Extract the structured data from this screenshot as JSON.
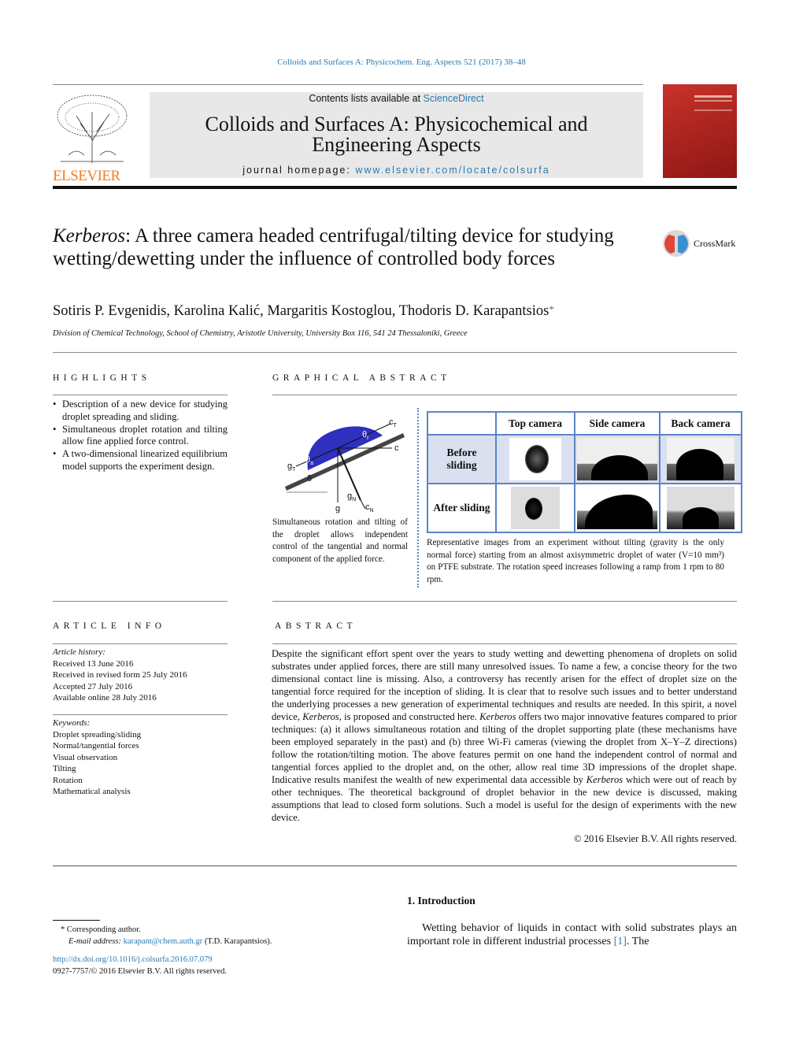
{
  "header": {
    "journal_reference": "Colloids and Surfaces A: Physicochem. Eng. Aspects 521 (2017) 38–48",
    "contents_prefix": "Contents lists available at ",
    "contents_link": "ScienceDirect",
    "journal_title": "Colloids and Surfaces A: Physicochemical and Engineering Aspects",
    "homepage_prefix": "journal homepage: ",
    "homepage_url": "www.elsevier.com/locate/colsurfa",
    "publisher_logo": "ELSEVIER",
    "crossmark": "CrossMark",
    "colors": {
      "link": "#2a7ab0",
      "elsevier_orange": "#f07e26",
      "cover_red": "#b0201e"
    }
  },
  "article": {
    "title_italic": "Kerberos",
    "title_rest": ": A three camera headed centrifugal/tilting device for studying wetting/dewetting under the influence of controlled body forces",
    "authors": "Sotiris P. Evgenidis, Karolina Kalić, Margaritis Kostoglou, Thodoris D. Karapantsios",
    "author_mark": "*",
    "affiliation": "Division of Chemical Technology, School of Chemistry, Aristotle University, University Box 116, 541 24 Thessaloniki, Greece"
  },
  "highlights": {
    "heading": "HIGHLIGHTS",
    "items": [
      "Description of a new device for studying droplet spreading and sliding.",
      "Simultaneous droplet rotation and tilting allow fine applied force control.",
      "A two-dimensional linearized equilibrium model supports the experiment design."
    ]
  },
  "graphical_abstract": {
    "heading": "GRAPHICAL ABSTRACT",
    "diagram_labels": {
      "cT": "c",
      "cT_sub": "T",
      "c": "c",
      "gT": "g",
      "gT_sub": "T",
      "theta_a": "θ",
      "theta_a_sub": "a",
      "theta_r": "θ",
      "theta_r_sub": "r",
      "delta": "δ",
      "g": "g",
      "gN": "g",
      "gN_sub": "N",
      "cN": "c",
      "cN_sub": "N"
    },
    "left_caption": "Simultaneous rotation and tilting of the droplet allows independent control of the tangential and normal component of the applied force.",
    "columns": [
      "Top camera",
      "Side camera",
      "Back camera"
    ],
    "rows": [
      "Before sliding",
      "After sliding"
    ],
    "right_caption": "Representative images from an experiment without tilting (gravity is the only normal force) starting from an almost axisymmetric droplet of water (V=10 mm³) on PTFE substrate. The rotation speed increases following a ramp from 1 rpm to 80 rpm."
  },
  "article_info": {
    "heading": "ARTICLE INFO",
    "history_label": "Article history:",
    "history": [
      "Received 13 June 2016",
      "Received in revised form 25 July 2016",
      "Accepted 27 July 2016",
      "Available online 28 July 2016"
    ],
    "keywords_label": "Keywords:",
    "keywords": [
      "Droplet spreading/sliding",
      "Normal/tangential forces",
      "Visual observation",
      "Tilting",
      "Rotation",
      "Mathematical analysis"
    ]
  },
  "abstract": {
    "heading": "ABSTRACT",
    "segments": [
      {
        "t": "Despite the significant effort spent over the years to study wetting and dewetting phenomena of droplets on solid substrates under applied forces, there are still many unresolved issues. To name a few, a concise theory for the two dimensional contact line is missing. Also, a controversy has recently arisen for the effect of droplet size on the tangential force required for the inception of sliding. It is clear that to resolve such issues and to better understand the underlying processes a new generation of experimental techniques and results are needed. In this spirit, a novel device, "
      },
      {
        "t": "Kerberos",
        "i": true
      },
      {
        "t": ", is proposed and constructed here. "
      },
      {
        "t": "Kerberos",
        "i": true
      },
      {
        "t": " offers two major innovative features compared to prior techniques: (a) it allows simultaneous rotation and tilting of the droplet supporting plate (these mechanisms have been employed separately in the past) and (b) three Wi-Fi cameras (viewing the droplet from X–Y–Z directions) follow the rotation/tilting motion. The above features permit on one hand the independent control of normal and tangential forces applied to the droplet and, on the other, allow real time 3D impressions of the droplet shape. Indicative results manifest the wealth of new experimental data accessible by "
      },
      {
        "t": "Kerberos",
        "i": true
      },
      {
        "t": " which were out of reach by other techniques. The theoretical background of droplet behavior in the new device is discussed, making assumptions that lead to closed form solutions. Such a model is useful for the design of experiments with the new device."
      }
    ],
    "copyright": "© 2016 Elsevier B.V. All rights reserved."
  },
  "footnote": {
    "mark": "*",
    "corresponding": "Corresponding author.",
    "email_label": "E-mail address: ",
    "email": "karapant@chem.auth.gr",
    "email_suffix": " (T.D. Karapantsios).",
    "doi": "http://dx.doi.org/10.1016/j.colsurfa.2016.07.079",
    "issn": "0927-7757/© 2016 Elsevier B.V. All rights reserved."
  },
  "introduction": {
    "heading": "1.  Introduction",
    "text_before": "Wetting behavior of liquids in contact with solid substrates plays an important role in different industrial processes ",
    "ref": "[1]",
    "text_after": ". The"
  }
}
